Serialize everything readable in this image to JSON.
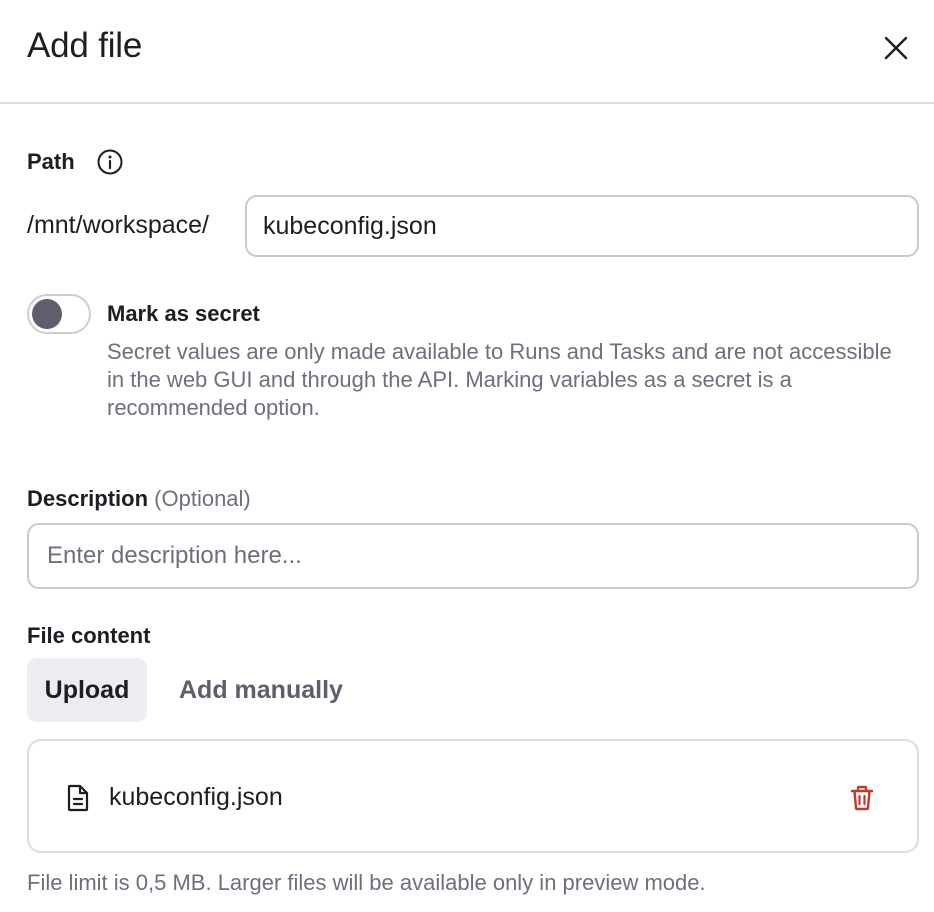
{
  "dialog": {
    "title": "Add file",
    "close_icon": "close-icon"
  },
  "path": {
    "label": "Path",
    "info_icon": "info-icon",
    "prefix": "/mnt/workspace/",
    "value": "kubeconfig.json"
  },
  "secret": {
    "label": "Mark as secret",
    "enabled": false,
    "help": "Secret values are only made available to Runs and Tasks and are not accessible in the web GUI and through the API. Marking variables as a secret is a recommended option."
  },
  "description": {
    "label": "Description",
    "optional": "(Optional)",
    "placeholder": "Enter description here...",
    "value": ""
  },
  "file_content": {
    "label": "File content",
    "tabs": [
      {
        "label": "Upload",
        "active": true
      },
      {
        "label": "Add manually",
        "active": false
      }
    ],
    "file": {
      "icon": "file-icon",
      "name": "kubeconfig.json",
      "delete_icon": "trash-icon"
    },
    "limit_note": "File limit is 0,5 MB. Larger files will be available only in preview mode."
  },
  "colors": {
    "delete": "#c0392b",
    "toggle_knob": "#5f5e6d",
    "muted_text": "#6f6e7c"
  }
}
